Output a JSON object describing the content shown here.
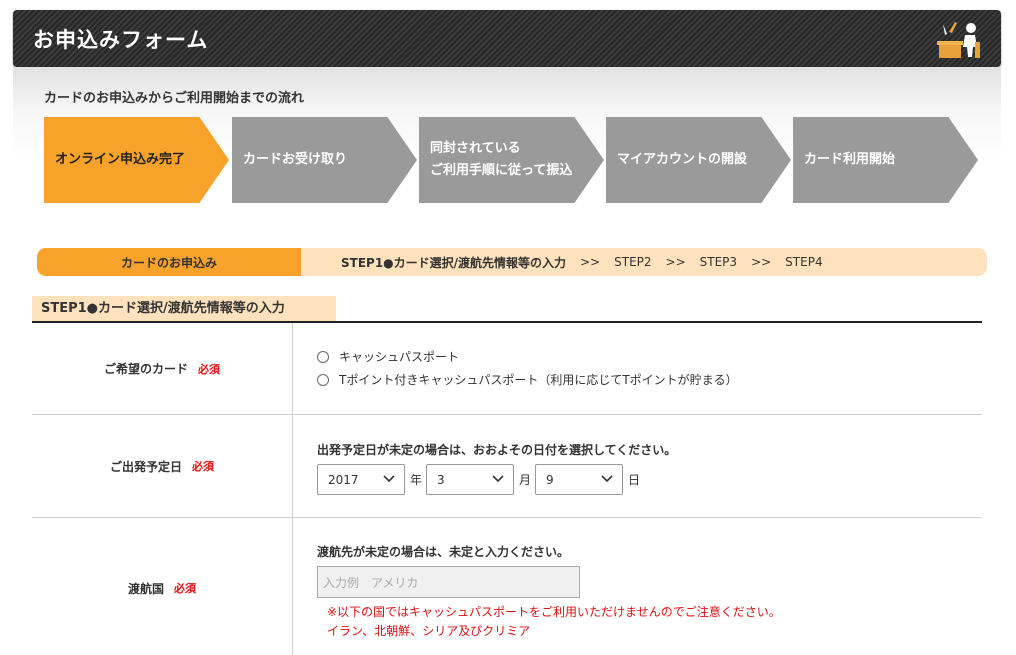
{
  "header": {
    "title": "お申込みフォーム"
  },
  "flow": {
    "title": "カードのお申込みからご利用開始までの流れ",
    "steps": [
      {
        "line1": "オンライン申込み完了",
        "line2": ""
      },
      {
        "line1": "カードお受け取り",
        "line2": ""
      },
      {
        "line1": "同封されている",
        "line2": "ご利用手順に従って振込"
      },
      {
        "line1": "マイアカウントの開設",
        "line2": ""
      },
      {
        "line1": "カード利用開始",
        "line2": ""
      }
    ]
  },
  "step_bar": {
    "tab_label": "カードのお申込み",
    "current": "STEP1●カード選択/渡航先情報等の入力",
    "separator": ">>",
    "steps": [
      "STEP2",
      "STEP3",
      "STEP4"
    ]
  },
  "section_title": "STEP1●カード選択/渡航先情報等の入力",
  "form": {
    "required_label": "必須",
    "card": {
      "label": "ご希望のカード",
      "options": [
        "キャッシュパスポート",
        "Tポイント付きキャッシュパスポート（利用に応じてTポイントが貯まる）"
      ]
    },
    "departure": {
      "label": "ご出発予定日",
      "note": "出発予定日が未定の場合は、おおよその日付を選択してください。",
      "year": "2017",
      "year_unit": "年",
      "month": "3",
      "month_unit": "月",
      "day": "9",
      "day_unit": "日"
    },
    "destination": {
      "label": "渡航国",
      "note": "渡航先が未定の場合は、未定と入力ください。",
      "placeholder": "入力例　アメリカ",
      "warning1": "※以下の国ではキャッシュパスポートをご利用いただけませんのでご注意ください。",
      "warning2": "イラン、北朝鮮、シリア及びクリミア"
    }
  },
  "colors": {
    "accent": "#f7a22b",
    "accent_light": "#fde2bd",
    "step_gray": "#9a9a9a",
    "required": "#dd1111"
  },
  "icons": [
    "desk-person-icon",
    "radio-icon",
    "chevron-down-icon"
  ]
}
